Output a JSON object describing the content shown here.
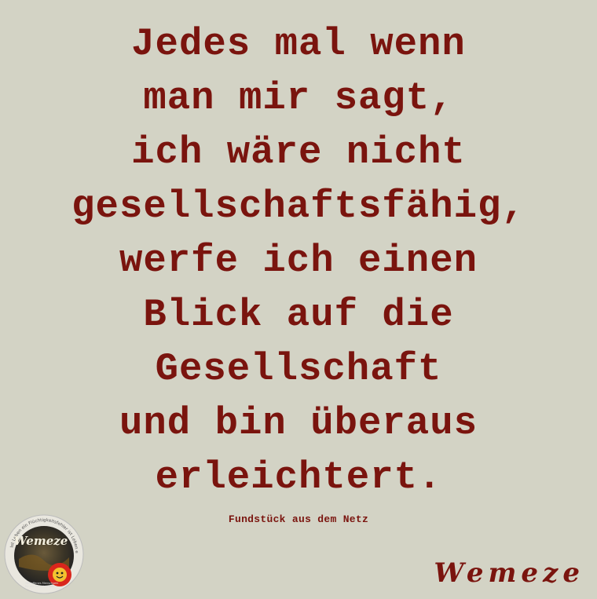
{
  "quote": {
    "lines": [
      "Jedes mal wenn",
      "man mir sagt,",
      "ich wäre nicht",
      "gesellschaftsfähig,",
      "werfe ich einen",
      "Blick auf die",
      "Gesellschaft",
      "und bin überaus",
      "erleichtert."
    ]
  },
  "source": "Fundstück aus dem Netz",
  "brand": {
    "name": "Wemeze",
    "logo_text": "Wemeze",
    "logo_ring_text": "Ist Leben ein Flüchtigkeitsfehler ist Leben ein Kunstwerk",
    "logo_small_text": "Weltoffenes Menschsein für die Gemeinschaft"
  },
  "colors": {
    "background": "#d3d3c5",
    "text": "#7a140e"
  }
}
